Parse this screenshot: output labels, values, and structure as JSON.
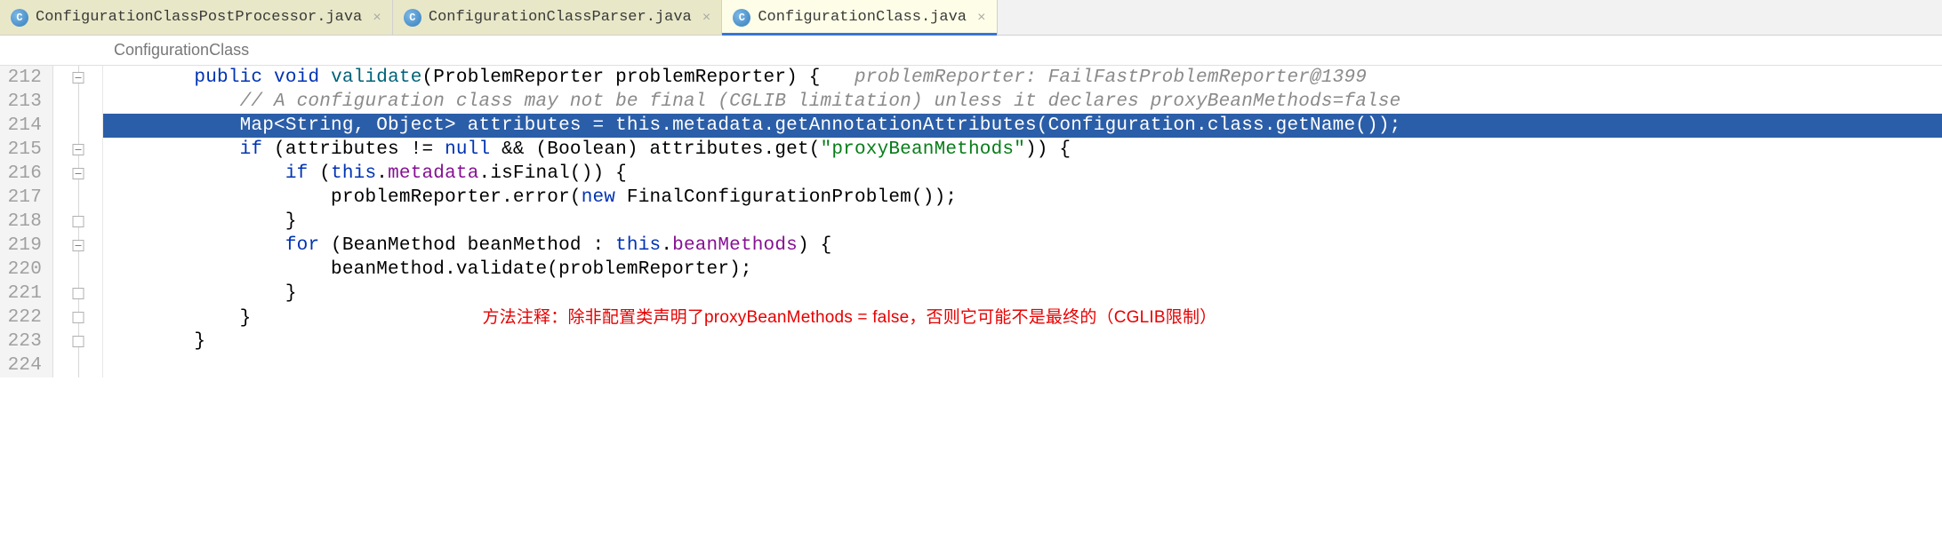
{
  "tabs": [
    {
      "label": "ConfigurationClassPostProcessor.java",
      "active": false
    },
    {
      "label": "ConfigurationClassParser.java",
      "active": false
    },
    {
      "label": "ConfigurationClass.java",
      "active": true
    }
  ],
  "breadcrumb": "ConfigurationClass",
  "gutter": {
    "start": 212,
    "lines": [
      "212",
      "213",
      "214",
      "215",
      "216",
      "217",
      "218",
      "219",
      "220",
      "221",
      "222",
      "223",
      "224"
    ]
  },
  "code": {
    "l212": {
      "indent": "        ",
      "kw1": "public",
      "kw2": "void",
      "name": "validate",
      "sig": "(ProblemReporter problemReporter) {",
      "hintLabel": "problemReporter: ",
      "hintValue": "FailFastProblemReporter@1399"
    },
    "l213": {
      "indent": "            ",
      "comment": "// A configuration class may not be final (CGLIB limitation) unless it declares proxyBeanMethods=false"
    },
    "l214": {
      "indent": "            ",
      "a": "Map<String, Object> attributes = ",
      "b": "this",
      "c": ".",
      "d": "metadata",
      "e": ".getAnnotationAttributes(Configuration.",
      "f": "class",
      "g": ".getName());"
    },
    "l215": {
      "indent": "            ",
      "a": "if",
      "b": " (attributes != ",
      "c": "null",
      "d": " && (Boolean) attributes.get(",
      "e": "\"proxyBeanMethods\"",
      "f": ")) {"
    },
    "l216": {
      "indent": "                ",
      "a": "if",
      "b": " (",
      "c": "this",
      "d": ".",
      "e": "metadata",
      "f": ".isFinal()) {"
    },
    "l217": {
      "indent": "                    ",
      "a": "problemReporter.error(",
      "b": "new",
      "c": " FinalConfigurationProblem());"
    },
    "l218": {
      "indent": "                ",
      "a": "}"
    },
    "l219": {
      "indent": "                ",
      "a": "for",
      "b": " (BeanMethod beanMethod : ",
      "c": "this",
      "d": ".",
      "e": "beanMethods",
      "f": ") {"
    },
    "l220": {
      "indent": "                    ",
      "a": "beanMethod.validate(problemReporter);"
    },
    "l221": {
      "indent": "                ",
      "a": "}"
    },
    "l222": {
      "indent": "            ",
      "a": "}"
    },
    "l223": {
      "indent": "        ",
      "a": "}"
    }
  },
  "annotation": "方法注释：除非配置类声明了proxyBeanMethods = false，否则它可能不是最终的（CGLIB限制）"
}
